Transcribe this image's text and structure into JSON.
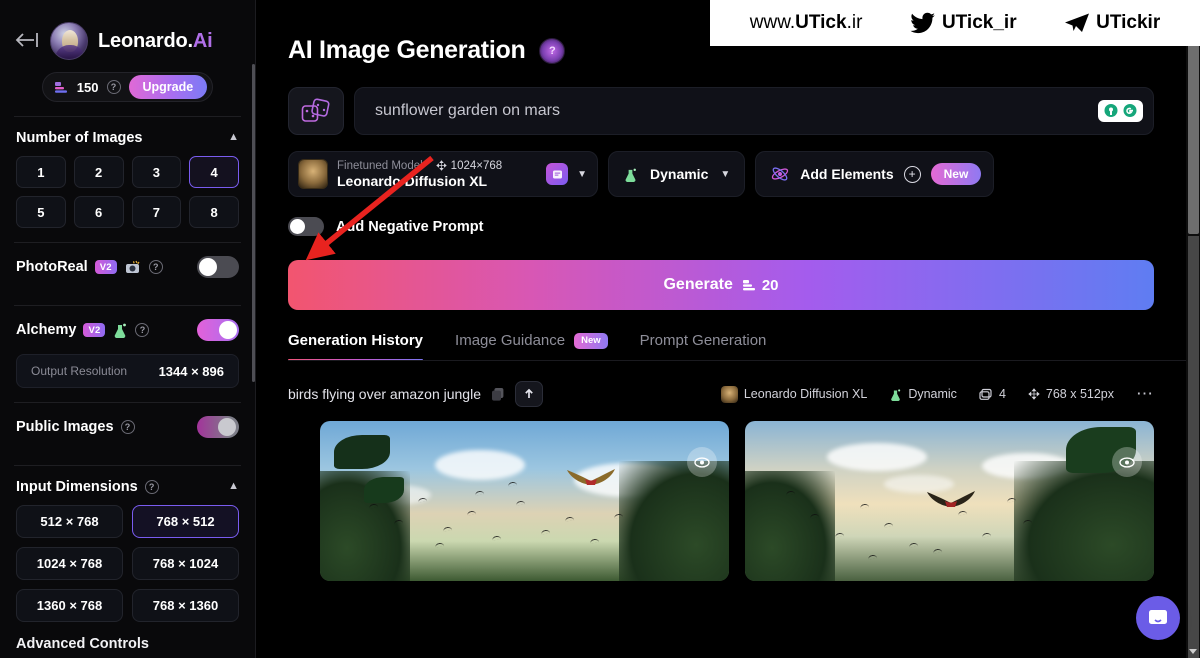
{
  "sidebar": {
    "back_icon": "back-arrow-icon",
    "brand_name": "Leonardo.",
    "brand_suffix": "Ai",
    "credits": {
      "coin_icon": "credit-coin-icon",
      "amount": "150",
      "help": "?",
      "upgrade_label": "Upgrade"
    },
    "number_of_images": {
      "title": "Number of Images",
      "collapse_icon": "chevron-up-icon",
      "options": [
        "1",
        "2",
        "3",
        "4",
        "5",
        "6",
        "7",
        "8"
      ],
      "selected": "4"
    },
    "photoreal": {
      "label": "PhotoReal",
      "badge": "V2",
      "icon": "camera-flash-icon",
      "help": "?",
      "enabled": false
    },
    "alchemy": {
      "label": "Alchemy",
      "badge": "V2",
      "icon": "potion-flask-icon",
      "help": "?",
      "enabled": true,
      "output_resolution_label": "Output Resolution",
      "output_resolution_value": "1344 × 896"
    },
    "public_images": {
      "label": "Public Images",
      "help": "?",
      "enabled": true
    },
    "input_dimensions": {
      "title": "Input Dimensions",
      "help": "?",
      "collapse_icon": "chevron-up-icon",
      "options": [
        "512 × 768",
        "768 × 512",
        "1024 × 768",
        "768 × 1024",
        "1360 × 768",
        "768 × 1360"
      ],
      "selected": "768 × 512"
    },
    "advanced_controls": "Advanced Controls"
  },
  "main": {
    "page_title": "AI Image Generation",
    "title_help": "?",
    "prompt": {
      "dice_icon": "dice-randomize-icon",
      "value": "sunflower garden on mars",
      "grammarly_icon": "grammarly-extension-icon"
    },
    "model": {
      "kind_label": "Finetuned Model",
      "dimensions": "1024×768",
      "dimensions_icon": "move-resize-icon",
      "name": "Leonardo Diffusion XL",
      "tag_icon": "model-tag-icon",
      "caret_icon": "chevron-down-icon"
    },
    "preset": {
      "icon": "potion-flask-icon",
      "label": "Dynamic",
      "caret_icon": "chevron-down-icon"
    },
    "elements": {
      "icon": "atom-elements-icon",
      "label": "Add Elements",
      "plus_icon": "plus-circle-icon",
      "badge": "New"
    },
    "negative_prompt": {
      "label": "Add Negative Prompt",
      "enabled": false
    },
    "generate": {
      "label": "Generate",
      "cost_icon": "credit-coin-icon",
      "cost": "20"
    },
    "tabs": [
      {
        "label": "Generation History",
        "active": true,
        "badge": ""
      },
      {
        "label": "Image Guidance",
        "active": false,
        "badge": "New"
      },
      {
        "label": "Prompt Generation",
        "active": false,
        "badge": ""
      }
    ],
    "history": {
      "prompt": "birds flying over amazon jungle",
      "copy_icon": "copy-icon",
      "share_icon": "upload-share-icon",
      "meta": {
        "model_thumb_icon": "model-thumbnail-icon",
        "model": "Leonardo Diffusion XL",
        "preset_icon": "potion-flask-icon",
        "preset": "Dynamic",
        "count_icon": "images-count-icon",
        "count": "4",
        "size_icon": "move-resize-icon",
        "size": "768 x 512px",
        "more_icon": "more-options-icon"
      },
      "images": [
        {
          "alt": "birds flying over amazon jungle daytime",
          "eye_icon": "eye-icon"
        },
        {
          "alt": "birds flying over amazon jungle sunset",
          "eye_icon": "eye-icon"
        }
      ]
    },
    "chat_icon": "chat-bubble-icon"
  },
  "watermark": {
    "site_prefix": "www.",
    "site_name": "UTick",
    "site_tld": ".ir",
    "twitter_icon": "twitter-bird-icon",
    "twitter_handle": "UTick_ir",
    "telegram_icon": "telegram-plane-icon",
    "telegram_handle": "UTickir"
  },
  "colors": {
    "accent_purple": "#7a5cf0",
    "accent_pink": "#e361d9",
    "background": "#000000",
    "panel": "#101118"
  }
}
